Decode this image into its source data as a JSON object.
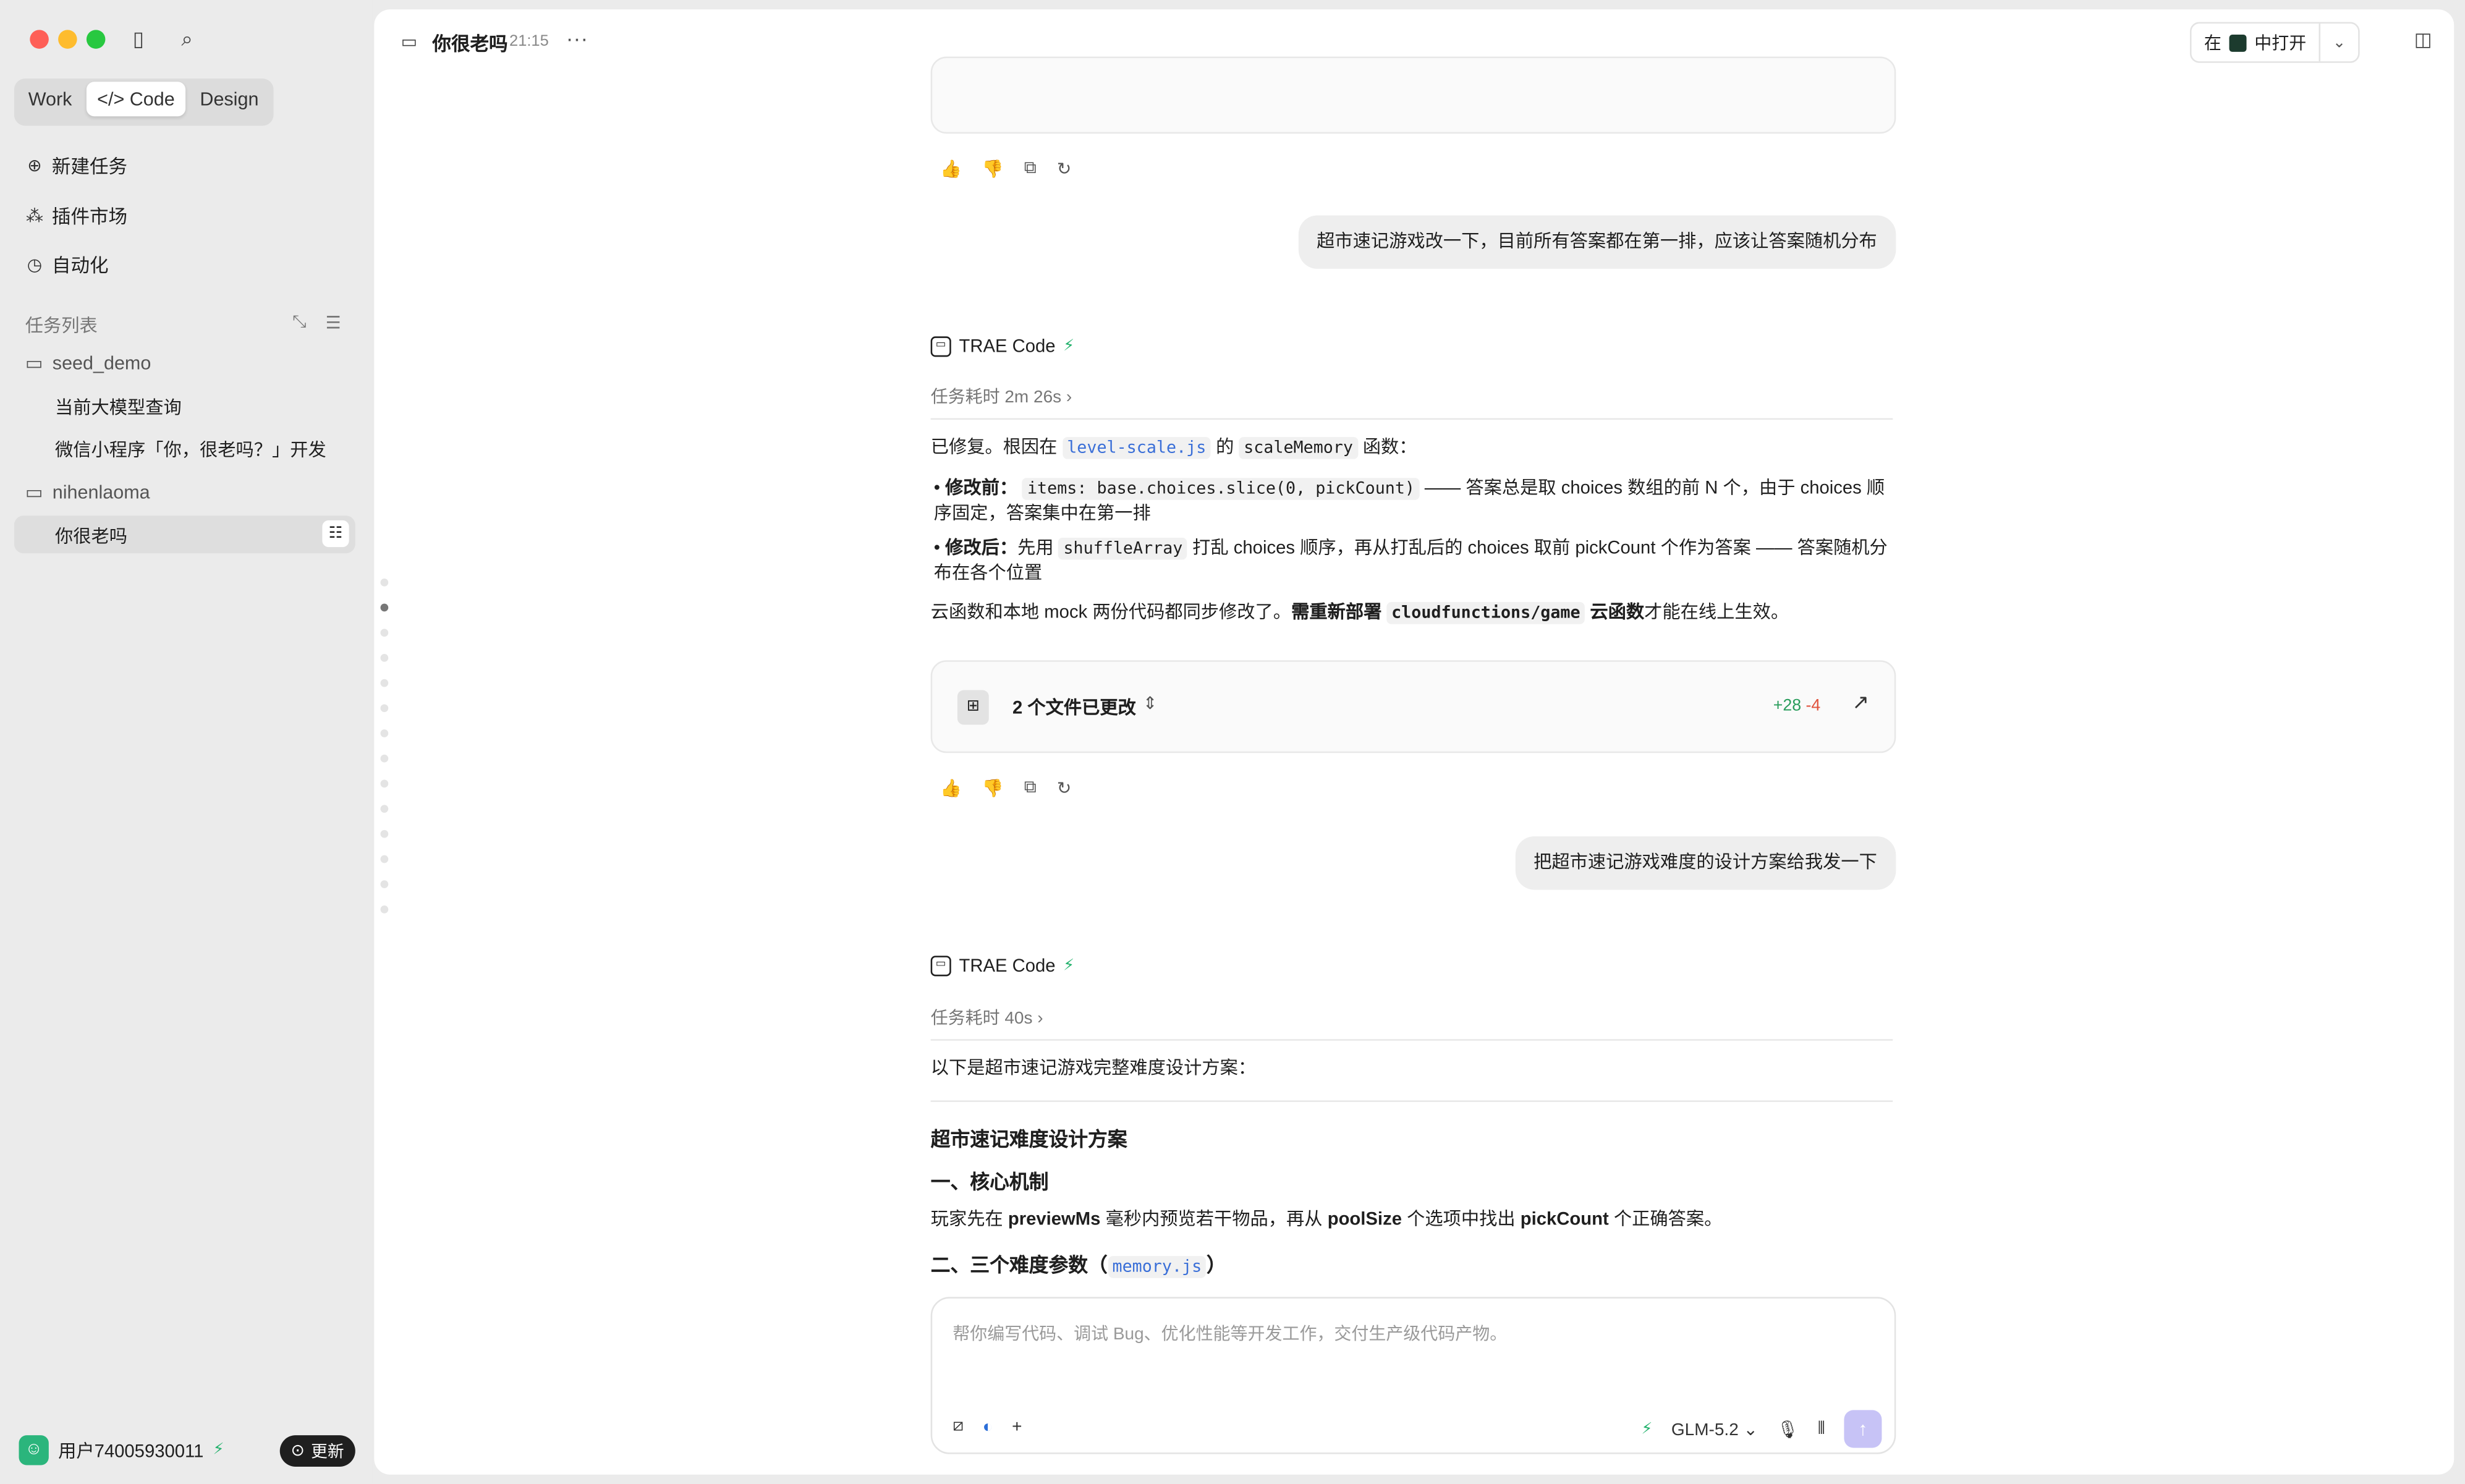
{
  "sidebar": {
    "tabs": [
      "Work",
      "Code",
      "Design"
    ],
    "active_tab": "Code",
    "nav": [
      {
        "label": "新建任务",
        "icon": "plus-circle-icon"
      },
      {
        "label": "插件市场",
        "icon": "plugin-icon"
      },
      {
        "label": "自动化",
        "icon": "alarm-clock-icon"
      }
    ],
    "section_title": "任务列表",
    "folders": [
      {
        "name": "seed_demo",
        "tasks": [
          "当前大模型查询",
          "微信小程序「你，很老吗？」开发"
        ]
      },
      {
        "name": "nihenlaoma",
        "tasks": [
          "你很老吗"
        ]
      }
    ],
    "user": {
      "name": "用户74005930011"
    },
    "update_label": "更新"
  },
  "header": {
    "title": "你很老吗",
    "time": "21:15",
    "open_in_prefix": "在",
    "open_in_suffix": "中打开"
  },
  "messages": {
    "user1": "超市速记游戏改一下，目前所有答案都在第一排，应该让答案随机分布",
    "bot_name": "TRAE Code",
    "dur1": "任务耗时 2m 26s",
    "reply1": {
      "intro_pre": "已修复。根因在",
      "file": "level-scale.js",
      "intro_mid": "的",
      "fn": "scaleMemory",
      "intro_post": "函数：",
      "b1_label": "修改前：",
      "b1_code": "items: base.choices.slice(0, pickCount)",
      "b1_text": "—— 答案总是取 choices 数组的前 N 个，由于 choices 顺序固定，答案集中在第一排",
      "b2_label": "修改后：",
      "b2_pre": "先用",
      "b2_code": "shuffleArray",
      "b2_text": "打乱 choices 顺序，再从打乱后的 choices 取前 pickCount 个作为答案 —— 答案随机分布在各个位置",
      "outro_pre": "云函数和本地 mock 两份代码都同步修改了。",
      "outro_bold": "需重新部署",
      "outro_code": "cloudfunctions/game",
      "outro_bold2": "云函数",
      "outro_post": "才能在线上生效。"
    },
    "changes": {
      "label": "2 个文件已更改",
      "added": "+28",
      "removed": "-4"
    },
    "user2": "把超市速记游戏难度的设计方案给我发一下",
    "dur2": "任务耗时 40s",
    "reply2": {
      "intro": "以下是超市速记游戏完整难度设计方案：",
      "h1": "超市速记难度设计方案",
      "h2": "一、核心机制",
      "p_pre": "玩家先在",
      "p_b1": "previewMs",
      "p_mid1": "毫秒内预览若干物品，再从",
      "p_b2": "poolSize",
      "p_mid2": "个选项中找出",
      "p_b3": "pickCount",
      "p_post": "个正确答案。",
      "h3_pre": "二、三个难度参数（",
      "h3_code": "memory.js",
      "h3_post": "）"
    }
  },
  "composer": {
    "placeholder": "帮你编写代码、调试 Bug、优化性能等开发工作，交付生产级代码产物。",
    "model": "GLM-5.2"
  }
}
